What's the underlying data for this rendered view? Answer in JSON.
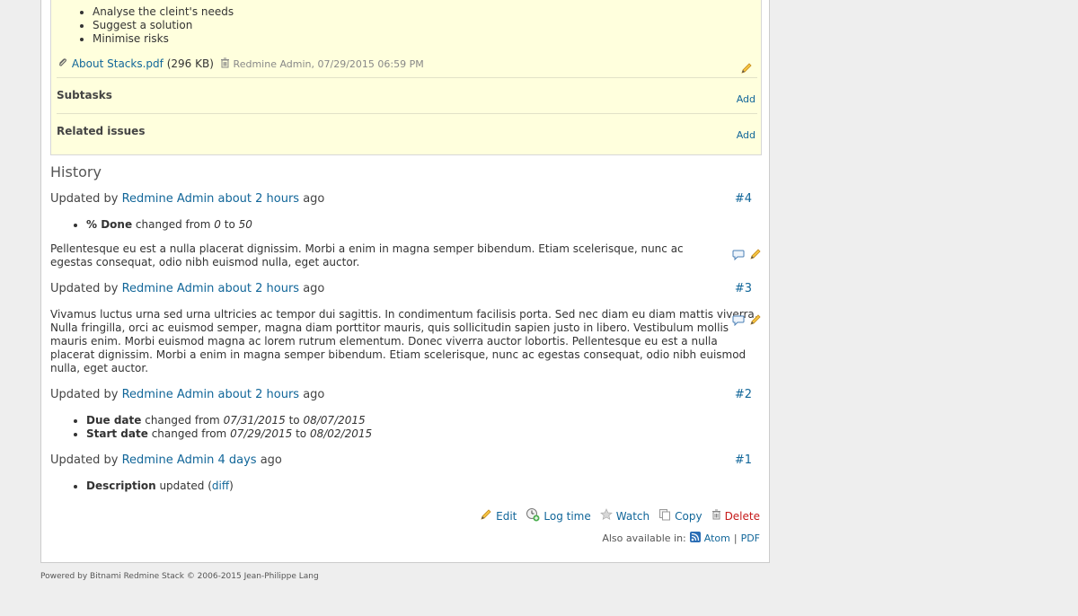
{
  "issue": {
    "description_items": [
      "Analyse the cleint's needs",
      "Suggest a solution",
      "Minimise risks"
    ],
    "attachment": {
      "name": "About Stacks.pdf",
      "size": "(296 KB)",
      "meta": "Redmine Admin, 07/29/2015 06:59 PM"
    },
    "subtasks_label": "Subtasks",
    "subtasks_add": "Add",
    "related_label": "Related issues",
    "related_add": "Add"
  },
  "history": {
    "title": "History",
    "journals": [
      {
        "prefix": "Updated by",
        "author": "Redmine Admin",
        "time": "about 2 hours",
        "suffix": "ago",
        "number": "#4",
        "details": [
          {
            "field": "% Done",
            "text": "changed from",
            "old": "0",
            "to": "to",
            "new": "50"
          }
        ],
        "note": "Pellentesque eu est a nulla placerat dignissim. Morbi a enim in magna semper bibendum. Etiam scelerisque, nunc ac egestas consequat, odio nibh euismod nulla, eget auctor."
      },
      {
        "prefix": "Updated by",
        "author": "Redmine Admin",
        "time": "about 2 hours",
        "suffix": "ago",
        "number": "#3",
        "note": "Vivamus luctus urna sed urna ultricies ac tempor dui sagittis. In condimentum facilisis porta. Sed nec diam eu diam mattis viverra. Nulla fringilla, orci ac euismod semper, magna diam porttitor mauris, quis sollicitudin sapien justo in libero. Vestibulum mollis mauris enim. Morbi euismod magna ac lorem rutrum elementum. Donec viverra auctor lobortis. Pellentesque eu est a nulla placerat dignissim. Morbi a enim in magna semper bibendum. Etiam scelerisque, nunc ac egestas consequat, odio nibh euismod nulla, eget auctor."
      },
      {
        "prefix": "Updated by",
        "author": "Redmine Admin",
        "time": "about 2 hours",
        "suffix": "ago",
        "number": "#2",
        "details": [
          {
            "field": "Due date",
            "text": "changed from",
            "old": "07/31/2015",
            "to": "to",
            "new": "08/07/2015"
          },
          {
            "field": "Start date",
            "text": "changed from",
            "old": "07/29/2015",
            "to": "to",
            "new": "08/02/2015"
          }
        ]
      },
      {
        "prefix": "Updated by",
        "author": "Redmine Admin",
        "time": "4 days",
        "suffix": "ago",
        "number": "#1",
        "description_detail": {
          "field": "Description",
          "text": "updated",
          "open": "(",
          "link": "diff",
          "close": ")"
        }
      }
    ]
  },
  "actions": {
    "edit": "Edit",
    "log_time": "Log time",
    "watch": "Watch",
    "copy": "Copy",
    "delete": "Delete"
  },
  "other_formats": {
    "label": "Also available in:",
    "atom": "Atom",
    "sep": "|",
    "pdf": "PDF"
  },
  "footer": {
    "text": "Powered by Bitnami Redmine Stack © 2006-2015 Jean-Philippe Lang"
  },
  "colors": {
    "link": "#116699",
    "delete": "#c61a1a",
    "issue_bg": "#ffffdd",
    "page_bg": "#eeeeee"
  }
}
